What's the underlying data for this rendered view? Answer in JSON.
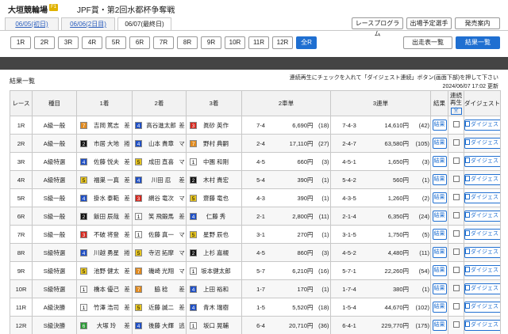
{
  "header": {
    "venue": "大垣競輪場",
    "grade": "F1",
    "race_title": "JPF賞・第2回水都杯争奪戦"
  },
  "day_tabs": [
    {
      "label": "06/05(初日)",
      "active": false
    },
    {
      "label": "06/06(2日目)",
      "active": false
    },
    {
      "label": "06/07(最終日)",
      "active": true
    }
  ],
  "header_buttons": [
    "レースプログラム",
    "出場予定選手",
    "発売案内"
  ],
  "race_buttons": [
    "1R",
    "2R",
    "3R",
    "4R",
    "5R",
    "6R",
    "7R",
    "8R",
    "9R",
    "10R",
    "11R",
    "12R",
    "全R"
  ],
  "actions": {
    "entries": "出走表一覧",
    "results": "結果一覧"
  },
  "section_title": "結果一覧",
  "note": "連続再生にチェックを入れて「ダイジェスト連続」ボタン(画面下部)を押して下さい",
  "updated": "2024/06/07 17:02 更新",
  "columns": {
    "race": "レース",
    "type": "種目",
    "first": "1着",
    "second": "2着",
    "third": "3着",
    "exacta": "2車単",
    "trifecta": "3連単",
    "result": "結果",
    "cont_play": "連続再生",
    "cont_all": "全",
    "digest": "ダイジェスト"
  },
  "button_labels": {
    "result": "結果",
    "digest": "ダイジェスト"
  },
  "rows": [
    {
      "race": "1R",
      "type": "A級一般",
      "p1": {
        "n": 7,
        "name": "吉岡 篤志",
        "t": "差"
      },
      "p2": {
        "n": 4,
        "name": "高谷進太郎",
        "t": "差"
      },
      "p3": {
        "n": 3,
        "name": "眞砂 英作",
        "t": ""
      },
      "ex_combo": "7-4",
      "ex_pay": "6,690円",
      "ex_pop": "(18)",
      "tri_combo": "7-4-3",
      "tri_pay": "14,610円",
      "tri_pop": "(42)"
    },
    {
      "race": "2R",
      "type": "A級一般",
      "p1": {
        "n": 2,
        "name": "市居 大地",
        "t": "捲"
      },
      "p2": {
        "n": 4,
        "name": "山本 貴章",
        "t": "マ"
      },
      "p3": {
        "n": 7,
        "name": "野村 典嗣",
        "t": ""
      },
      "ex_combo": "2-4",
      "ex_pay": "17,110円",
      "ex_pop": "(27)",
      "tri_combo": "2-4-7",
      "tri_pay": "63,580円",
      "tri_pop": "(105)"
    },
    {
      "race": "3R",
      "type": "A級特選",
      "p1": {
        "n": 4,
        "name": "佐藤 悦夫",
        "t": "差"
      },
      "p2": {
        "n": 5,
        "name": "成田 直喜",
        "t": "マ"
      },
      "p3": {
        "n": 1,
        "name": "中園 和剛",
        "t": ""
      },
      "ex_combo": "4-5",
      "ex_pay": "660円",
      "ex_pop": "(3)",
      "tri_combo": "4-5-1",
      "tri_pay": "1,650円",
      "tri_pop": "(3)"
    },
    {
      "race": "4R",
      "type": "A級特選",
      "p1": {
        "n": 5,
        "name": "福巣 一真",
        "t": "差"
      },
      "p2": {
        "n": 4,
        "name": "川田 忍",
        "t": "差"
      },
      "p3": {
        "n": 2,
        "name": "木村 貴宏",
        "t": ""
      },
      "ex_combo": "5-4",
      "ex_pay": "390円",
      "ex_pop": "(1)",
      "tri_combo": "5-4-2",
      "tri_pay": "560円",
      "tri_pop": "(1)"
    },
    {
      "race": "5R",
      "type": "S級一般",
      "p1": {
        "n": 4,
        "name": "掛水 泰範",
        "t": "差"
      },
      "p2": {
        "n": 3,
        "name": "網谷 竜次",
        "t": "マ"
      },
      "p3": {
        "n": 5,
        "name": "齋藤 竜也",
        "t": ""
      },
      "ex_combo": "4-3",
      "ex_pay": "390円",
      "ex_pop": "(1)",
      "tri_combo": "4-3-5",
      "tri_pay": "1,260円",
      "tri_pop": "(2)"
    },
    {
      "race": "6R",
      "type": "S級一般",
      "p1": {
        "n": 2,
        "name": "飯田 辰哉",
        "t": "差"
      },
      "p2": {
        "n": 1,
        "name": "笑 飛鍛馬",
        "t": "差"
      },
      "p3": {
        "n": 4,
        "name": "仁藤 秀",
        "t": ""
      },
      "ex_combo": "2-1",
      "ex_pay": "2,800円",
      "ex_pop": "(11)",
      "tri_combo": "2-1-4",
      "tri_pay": "6,350円",
      "tri_pop": "(24)"
    },
    {
      "race": "7R",
      "type": "S級一般",
      "p1": {
        "n": 3,
        "name": "不破 将登",
        "t": "差"
      },
      "p2": {
        "n": 1,
        "name": "佐藤 真一",
        "t": "マ"
      },
      "p3": {
        "n": 5,
        "name": "星野 辰也",
        "t": ""
      },
      "ex_combo": "3-1",
      "ex_pay": "270円",
      "ex_pop": "(1)",
      "tri_combo": "3-1-5",
      "tri_pay": "1,750円",
      "tri_pop": "(5)"
    },
    {
      "race": "8R",
      "type": "S級特選",
      "p1": {
        "n": 4,
        "name": "川越 勇星",
        "t": "捲"
      },
      "p2": {
        "n": 5,
        "name": "寺沼 拓摩",
        "t": "マ"
      },
      "p3": {
        "n": 2,
        "name": "上杉 嘉槻",
        "t": ""
      },
      "ex_combo": "4-5",
      "ex_pay": "860円",
      "ex_pop": "(3)",
      "tri_combo": "4-5-2",
      "tri_pay": "4,480円",
      "tri_pop": "(11)"
    },
    {
      "race": "9R",
      "type": "S級特選",
      "p1": {
        "n": 5,
        "name": "池野 健太",
        "t": "差"
      },
      "p2": {
        "n": 7,
        "name": "磯崎 光翔",
        "t": "マ"
      },
      "p3": {
        "n": 1,
        "name": "坂本健太郎",
        "t": ""
      },
      "ex_combo": "5-7",
      "ex_pay": "6,210円",
      "ex_pop": "(16)",
      "tri_combo": "5-7-1",
      "tri_pay": "22,260円",
      "tri_pop": "(54)"
    },
    {
      "race": "10R",
      "type": "S級特選",
      "p1": {
        "n": 1,
        "name": "橋本 優己",
        "t": "差"
      },
      "p2": {
        "n": 7,
        "name": "脇 稔",
        "t": "差"
      },
      "p3": {
        "n": 4,
        "name": "上田 裕和",
        "t": ""
      },
      "ex_combo": "1-7",
      "ex_pay": "170円",
      "ex_pop": "(1)",
      "tri_combo": "1-7-4",
      "tri_pay": "380円",
      "tri_pop": "(1)"
    },
    {
      "race": "11R",
      "type": "A級決勝",
      "p1": {
        "n": 1,
        "name": "竹澤 浩司",
        "t": "差"
      },
      "p2": {
        "n": 5,
        "name": "近藤 誠二",
        "t": "差"
      },
      "p3": {
        "n": 4,
        "name": "青木 瑞樹",
        "t": ""
      },
      "ex_combo": "1-5",
      "ex_pay": "5,520円",
      "ex_pop": "(18)",
      "tri_combo": "1-5-4",
      "tri_pay": "44,670円",
      "tri_pop": "(102)"
    },
    {
      "race": "12R",
      "type": "S級決勝",
      "p1": {
        "n": 6,
        "name": "大塚 玲",
        "t": "差"
      },
      "p2": {
        "n": 4,
        "name": "後藤 大輝",
        "t": "逃"
      },
      "p3": {
        "n": 1,
        "name": "坂口 晃輔",
        "t": ""
      },
      "ex_combo": "6-4",
      "ex_pay": "20,710円",
      "ex_pop": "(36)",
      "tri_combo": "6-4-1",
      "tri_pay": "229,770円",
      "tri_pop": "(175)"
    }
  ]
}
